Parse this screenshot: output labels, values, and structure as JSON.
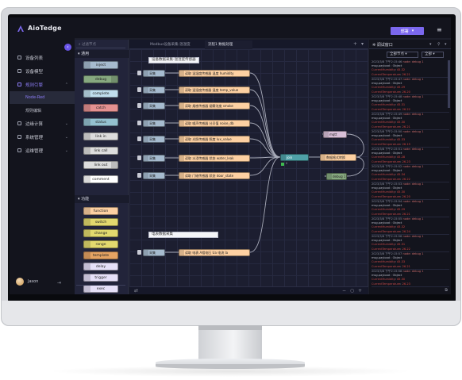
{
  "app": {
    "brand": "AioTedge"
  },
  "topbar": {
    "deploy_label": "部署",
    "menu_icon": "hamburger-icon"
  },
  "sidebar": {
    "items": [
      {
        "label": "设备列表",
        "icon": "device-icon"
      },
      {
        "label": "设备模型",
        "icon": "model-icon"
      },
      {
        "label": "规则引擎",
        "icon": "rule-icon",
        "active": true
      },
      {
        "label": "边缘计算",
        "icon": "edge-icon"
      },
      {
        "label": "系统管理",
        "icon": "settings-icon"
      },
      {
        "label": "运维管理",
        "icon": "ops-icon"
      }
    ],
    "sub_items": [
      "Node-Red",
      "规则编辑"
    ],
    "user": "Jason"
  },
  "palette": {
    "search_placeholder": "过滤节点",
    "section1": "通用",
    "section2": "功能",
    "common_nodes": [
      {
        "label": "inject",
        "color": "#a6bbcf"
      },
      {
        "label": "debug",
        "color": "#87a980"
      },
      {
        "label": "complete",
        "color": "#c0deed"
      },
      {
        "label": "catch",
        "color": "#e49191"
      },
      {
        "label": "status",
        "color": "#94c1d0"
      },
      {
        "label": "link in",
        "color": "#dddddd"
      },
      {
        "label": "link call",
        "color": "#dddddd"
      },
      {
        "label": "link out",
        "color": "#dddddd"
      },
      {
        "label": "comment",
        "color": "#ffffff"
      }
    ],
    "function_nodes": [
      {
        "label": "function",
        "color": "#fdd0a2"
      },
      {
        "label": "switch",
        "color": "#e2d96e"
      },
      {
        "label": "change",
        "color": "#e2d96e"
      },
      {
        "label": "range",
        "color": "#e2d96e"
      },
      {
        "label": "template",
        "color": "#e5a363"
      },
      {
        "label": "delay",
        "color": "#e6e0f8"
      },
      {
        "label": "trigger",
        "color": "#e6e0f8"
      },
      {
        "label": "exec",
        "color": "#e6e0f8"
      }
    ]
  },
  "flow": {
    "tabs": [
      "Modbus设备采集-温湿度",
      "流程1 数据处理"
    ],
    "comment1": "设备数据采集-温湿度传感器",
    "comment2": "电表数据采集",
    "inject_label": "采集",
    "functions": [
      "读取 温湿度传感器 温度 humidity",
      "读取 温湿度传感器 湿度 temp_value",
      "读取 烟感传感器 烟雾浓度 smoke",
      "读取 噪声传感器 分贝值 noise_db",
      "读取 光照传感器 照度 lux_value",
      "读取 水浸传感器 状态 water_leak",
      "读取 门磁传感器 状态 door_state",
      "读取 电表 A相电压 Ua 电流 Ia"
    ],
    "join_label": "join",
    "join_status": "0",
    "transform_label": "数据格式转换",
    "mqtt_label": "mqtt",
    "debug_label": "debug 1"
  },
  "debug": {
    "title": "调试窗口",
    "filter_all": "全部节点",
    "filter_clear": "全部",
    "foot_icon": "popout-icon",
    "entries": [
      {
        "meta": "2023/3/8 下午2:15:46",
        "node": "node: debug 1",
        "topic": "msg.payload : Object",
        "key": "CurrentHumidity",
        "val": "45.32",
        "key2": "CurrentTemperature",
        "val2": "26.21"
      },
      {
        "meta": "2023/3/8 下午2:15:47",
        "node": "node: debug 1",
        "topic": "msg.payload : Object",
        "key": "CurrentHumidity",
        "val": "45.29",
        "key2": "CurrentTemperature",
        "val2": "26.20"
      },
      {
        "meta": "2023/3/8 下午2:15:48",
        "node": "node: debug 1",
        "topic": "msg.payload : Object",
        "key": "CurrentHumidity",
        "val": "45.31",
        "key2": "CurrentTemperature",
        "val2": "26.22"
      },
      {
        "meta": "2023/3/8 下午2:15:49",
        "node": "node: debug 1",
        "topic": "msg.payload : Object",
        "key": "CurrentHumidity",
        "val": "45.30",
        "key2": "CurrentTemperature",
        "val2": "26.21"
      },
      {
        "meta": "2023/3/8 下午2:15:50",
        "node": "node: debug 1",
        "topic": "msg.payload : Object",
        "key": "CurrentHumidity",
        "val": "45.33",
        "key2": "CurrentTemperature",
        "val2": "26.19"
      },
      {
        "meta": "2023/3/8 下午2:15:51",
        "node": "node: debug 1",
        "topic": "msg.payload : Object",
        "key": "CurrentHumidity",
        "val": "45.28",
        "key2": "CurrentTemperature",
        "val2": "26.23"
      },
      {
        "meta": "2023/3/8 下午2:15:52",
        "node": "node: debug 1",
        "topic": "msg.payload : Object",
        "key": "CurrentHumidity",
        "val": "45.34",
        "key2": "CurrentTemperature",
        "val2": "26.22"
      },
      {
        "meta": "2023/3/8 下午2:15:53",
        "node": "node: debug 1",
        "topic": "msg.payload : Object",
        "key": "CurrentHumidity",
        "val": "45.30",
        "key2": "CurrentTemperature",
        "val2": "26.20"
      },
      {
        "meta": "2023/3/8 下午2:15:54",
        "node": "node: debug 1",
        "topic": "msg.payload : Object",
        "key": "CurrentHumidity",
        "val": "45.29",
        "key2": "CurrentTemperature",
        "val2": "26.21"
      },
      {
        "meta": "2023/3/8 下午2:15:55",
        "node": "node: debug 1",
        "topic": "msg.payload : Object",
        "key": "CurrentHumidity",
        "val": "45.32",
        "key2": "CurrentTemperature",
        "val2": "26.24"
      },
      {
        "meta": "2023/3/8 下午2:15:56",
        "node": "node: debug 1",
        "topic": "msg.payload : Object",
        "key": "CurrentHumidity",
        "val": "45.31",
        "key2": "CurrentTemperature",
        "val2": "26.22"
      },
      {
        "meta": "2023/3/8 下午2:15:57",
        "node": "node: debug 1",
        "topic": "msg.payload : Object",
        "key": "CurrentHumidity",
        "val": "45.33",
        "key2": "CurrentTemperature",
        "val2": "26.21"
      },
      {
        "meta": "2023/3/8 下午2:15:58",
        "node": "node: debug 1",
        "topic": "msg.payload : Object",
        "key": "CurrentHumidity",
        "val": "45.30",
        "key2": "CurrentTemperature",
        "val2": "26.23"
      }
    ]
  }
}
